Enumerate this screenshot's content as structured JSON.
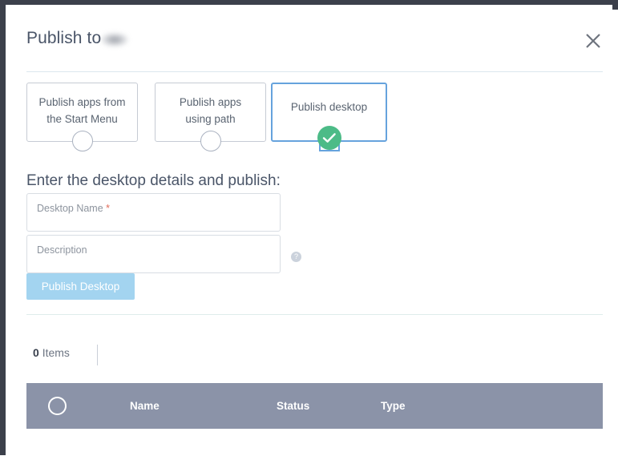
{
  "dialog": {
    "title": "Publish to",
    "redacted_label": "",
    "close_icon": "close-icon"
  },
  "options": {
    "cards": [
      {
        "label_line1": "Publish apps from",
        "label_line2": "the Start Menu",
        "selected": false
      },
      {
        "label_line1": "Publish apps",
        "label_line2": "using path",
        "selected": false
      },
      {
        "label_line1": "Publish desktop",
        "label_line2": "",
        "selected": true
      }
    ]
  },
  "form": {
    "heading": "Enter the desktop details and publish:",
    "desktop_name": {
      "placeholder": "Desktop Name",
      "required_mark": "*",
      "value": ""
    },
    "description": {
      "placeholder": "Description",
      "value": ""
    },
    "help_icon_label": "?",
    "publish_button": "Publish Desktop"
  },
  "list": {
    "items_count": "0",
    "items_label": "Items"
  },
  "table": {
    "columns": [
      "Name",
      "Status",
      "Type"
    ],
    "rows": []
  },
  "colors": {
    "accent_blue": "#66a3dd",
    "button_blue": "#a3d4f0",
    "check_green": "#4cbb87",
    "table_header": "#8b93a8",
    "required_red": "#e06c5a",
    "frame_dark": "#3c404b"
  }
}
